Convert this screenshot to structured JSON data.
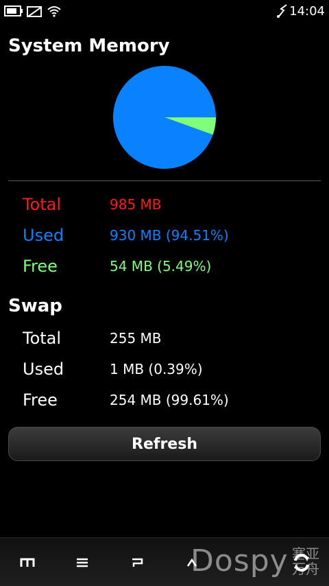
{
  "status": {
    "time": "14:04",
    "icons": [
      "battery-icon",
      "no-sim-icon",
      "wifi-icon",
      "usb-icon"
    ]
  },
  "title": "System Memory",
  "memory": {
    "pie": {
      "used_pct": 94.51,
      "free_pct": 5.49,
      "used_color": "#0a82ff",
      "free_color": "#7dff7a"
    },
    "rows": [
      {
        "label": "Total",
        "value": "985 MB",
        "color": "#ff1a1a"
      },
      {
        "label": "Used",
        "value": "930 MB (94.51%)",
        "color": "#0a82ff"
      },
      {
        "label": "Free",
        "value": "54 MB (5.49%)",
        "color": "#7dff7a"
      }
    ]
  },
  "swap": {
    "title": "Swap",
    "rows": [
      {
        "label": "Total",
        "value": "255 MB"
      },
      {
        "label": "Used",
        "value": "1 MB (0.39%)"
      },
      {
        "label": "Free",
        "value": "254 MB (99.61%)"
      }
    ]
  },
  "refresh_label": "Refresh",
  "toolbar": {
    "icons": [
      "menu-m-icon",
      "list-icon",
      "back-p-icon",
      "up-caret-icon",
      "refresh-icon"
    ]
  },
  "watermark": {
    "text": "Dospy",
    "cn": "塞亚 万舟"
  }
}
